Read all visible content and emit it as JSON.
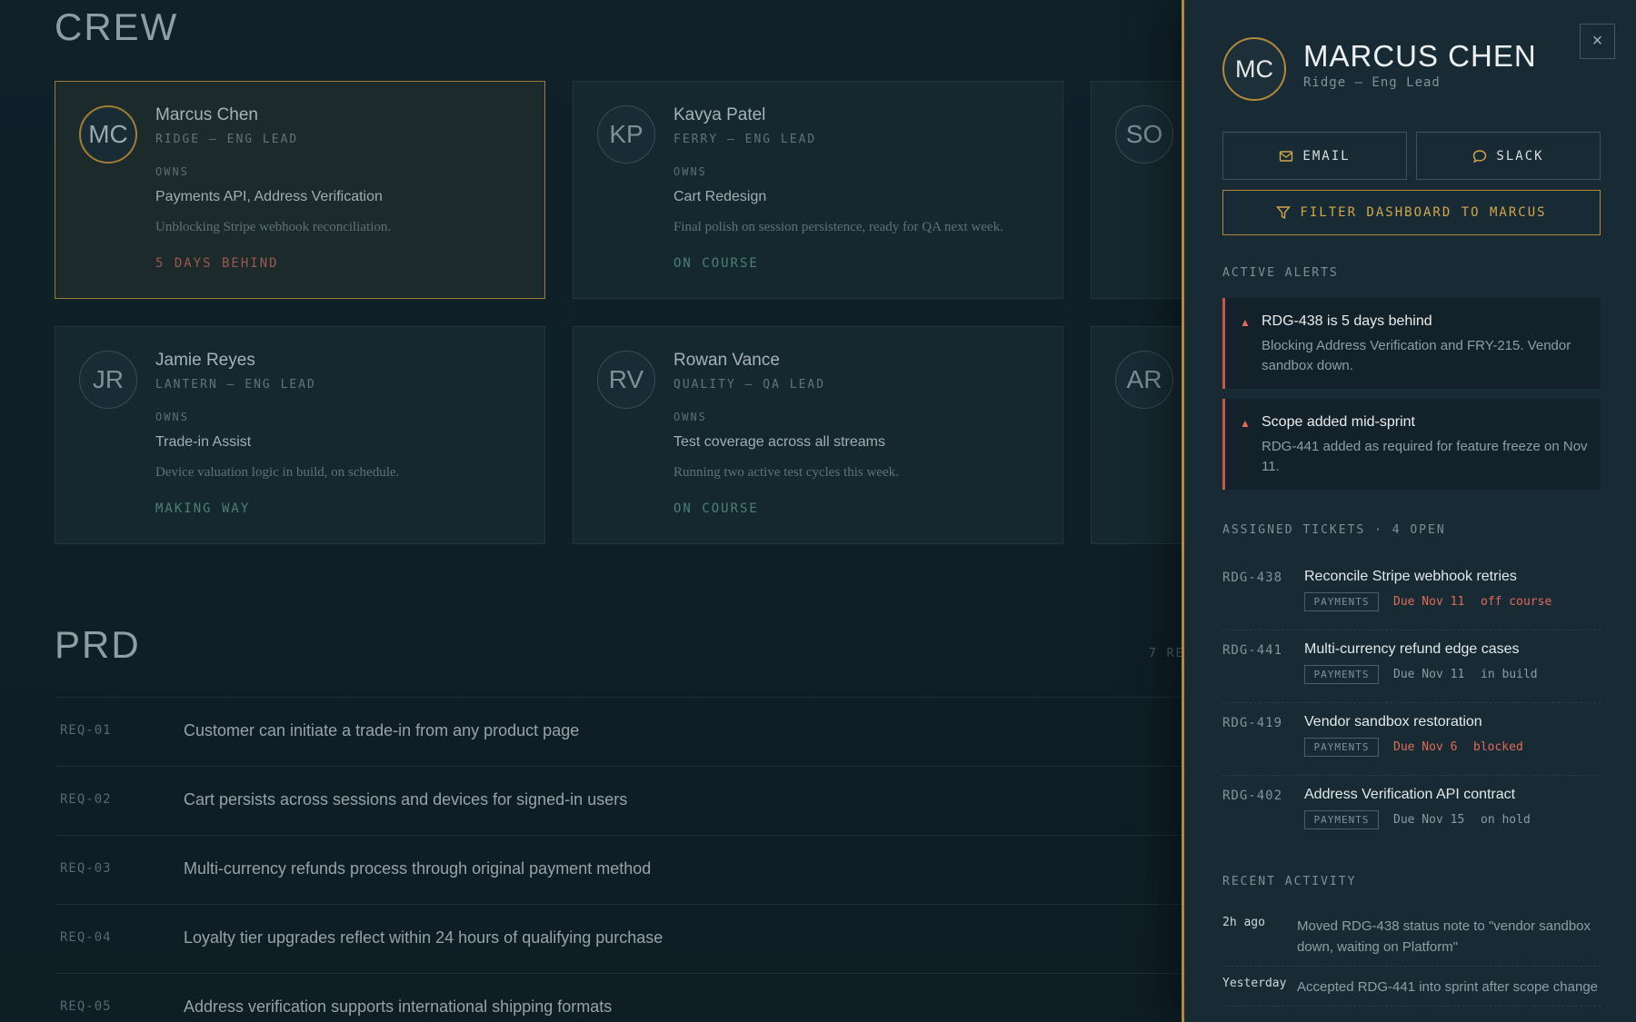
{
  "crew": {
    "title": "CREW",
    "members": [
      {
        "initials": "MC",
        "name": "Marcus Chen",
        "role": "RIDGE — ENG LEAD",
        "owns_label": "OWNS",
        "owns": "Payments API, Address Verification",
        "note": "Unblocking Stripe webhook reconciliation.",
        "status": "5 DAYS BEHIND"
      },
      {
        "initials": "KP",
        "name": "Kavya Patel",
        "role": "FERRY — ENG LEAD",
        "owns_label": "OWNS",
        "owns": "Cart Redesign",
        "note": "Final polish on session persistence, ready for QA next week.",
        "status": "ON COURSE"
      },
      {
        "initials": "SO"
      },
      {
        "initials": "JR",
        "name": "Jamie Reyes",
        "role": "LANTERN — ENG LEAD",
        "owns_label": "OWNS",
        "owns": "Trade-in Assist",
        "note": "Device valuation logic in build, on schedule.",
        "status": "MAKING WAY"
      },
      {
        "initials": "RV",
        "name": "Rowan Vance",
        "role": "QUALITY — QA LEAD",
        "owns_label": "OWNS",
        "owns": "Test coverage across all streams",
        "note": "Running two active test cycles this week.",
        "status": "ON COURSE"
      },
      {
        "initials": "AR"
      }
    ]
  },
  "prd": {
    "title": "PRD",
    "count_label": "7 RE",
    "requirements": [
      {
        "id": "REQ-01",
        "text": "Customer can initiate a trade-in from any product page"
      },
      {
        "id": "REQ-02",
        "text": "Cart persists across sessions and devices for signed-in users"
      },
      {
        "id": "REQ-03",
        "text": "Multi-currency refunds process through original payment method"
      },
      {
        "id": "REQ-04",
        "text": "Loyalty tier upgrades reflect within 24 hours of qualifying purchase"
      },
      {
        "id": "REQ-05",
        "text": "Address verification supports international shipping formats"
      }
    ]
  },
  "drawer": {
    "close": "×",
    "initials": "MC",
    "name": "MARCUS CHEN",
    "role": "Ridge — Eng Lead",
    "email_label": "EMAIL",
    "slack_label": "SLACK",
    "filter_label": "FILTER DASHBOARD TO MARCUS",
    "alerts_title": "ACTIVE ALERTS",
    "alerts": [
      {
        "icon": "▲",
        "title": "RDG-438 is 5 days behind",
        "body": "Blocking Address Verification and FRY-215. Vendor sandbox down."
      },
      {
        "icon": "▲",
        "title": "Scope added mid-sprint",
        "body": "RDG-441 added as required for feature freeze on Nov 11."
      }
    ],
    "tickets_title": "ASSIGNED TICKETS · 4 OPEN",
    "tickets": [
      {
        "id": "RDG-438",
        "title": "Reconcile Stripe webhook retries",
        "tag": "PAYMENTS",
        "due": "Due Nov 11",
        "state": "off course"
      },
      {
        "id": "RDG-441",
        "title": "Multi-currency refund edge cases",
        "tag": "PAYMENTS",
        "due": "Due Nov 11",
        "state": "in build"
      },
      {
        "id": "RDG-419",
        "title": "Vendor sandbox restoration",
        "tag": "PAYMENTS",
        "due": "Due Nov 6",
        "state": "blocked"
      },
      {
        "id": "RDG-402",
        "title": "Address Verification API contract",
        "tag": "PAYMENTS",
        "due": "Due Nov 15",
        "state": "on hold"
      }
    ],
    "activity_title": "RECENT ACTIVITY",
    "activity": [
      {
        "time": "2h ago",
        "text": "Moved RDG-438 status note to \"vendor sandbox down, waiting on Platform\""
      },
      {
        "time": "Yesterday",
        "text": "Accepted RDG-441 into sprint after scope change"
      }
    ]
  },
  "colors": {
    "accent_gold": "#b08a3a",
    "alert_red": "#e06a5a",
    "status_green": "#4d7f73"
  }
}
